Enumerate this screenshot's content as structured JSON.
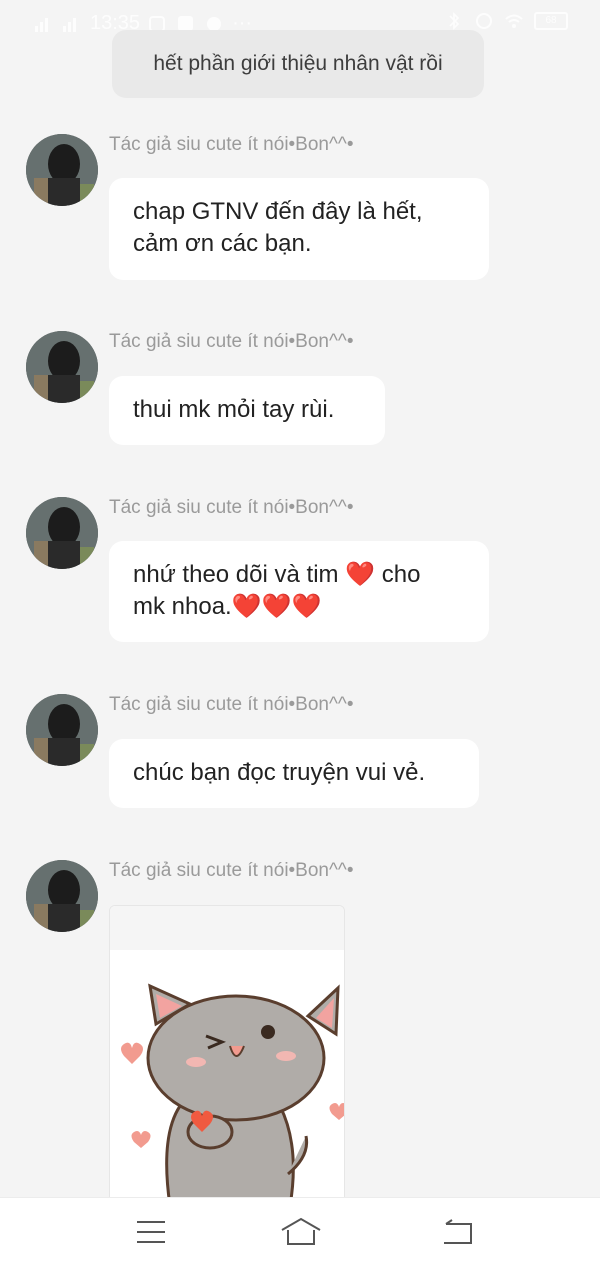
{
  "status_bar": {
    "time": "13:35",
    "battery": "68"
  },
  "system_message": "hết phần giới thiệu nhân vật rồi",
  "messages": [
    {
      "sender": "Tác giả siu cute ít nói•Bon^^•",
      "line1": "chap GTNV đến đây là hết,",
      "line2": "cảm ơn các bạn."
    },
    {
      "sender": "Tác giả siu cute ít nói•Bon^^•",
      "line1": "thui mk mỏi tay rùi."
    },
    {
      "sender": "Tác giả siu cute ít nói•Bon^^•",
      "line1_text": "nhứ theo dõi và tim ",
      "line1_heart": "❤️",
      "line1_after": " cho",
      "line2_text": "mk nhoa.",
      "line2_hearts": "❤️❤️❤️"
    },
    {
      "sender": "Tác giả siu cute ít nói•Bon^^•",
      "line1": "chúc bạn đọc truyện vui vẻ."
    },
    {
      "sender": "Tác giả siu cute ít nói•Bon^^•",
      "sticker": "cat-heart-sticker"
    }
  ],
  "nav": {
    "menu_icon": "menu-icon",
    "home_icon": "home-icon",
    "back_icon": "back-icon"
  }
}
